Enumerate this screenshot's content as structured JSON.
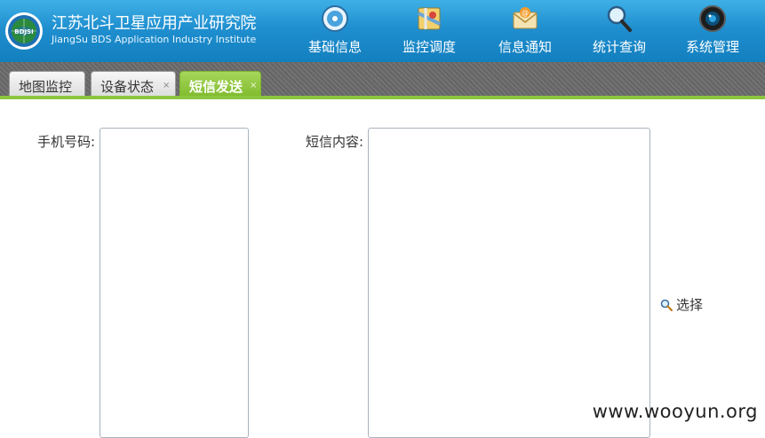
{
  "brand": {
    "name_cn": "江苏北斗卫星应用产业研究院",
    "name_en": "JiangSu BDS Application Industry Institute",
    "logo_text": "BDJSI"
  },
  "nav": [
    {
      "label": "基础信息",
      "icon": "info-disc-icon"
    },
    {
      "label": "监控调度",
      "icon": "map-monitor-icon"
    },
    {
      "label": "信息通知",
      "icon": "mail-envelope-icon"
    },
    {
      "label": "统计查询",
      "icon": "magnifier-icon"
    },
    {
      "label": "系统管理",
      "icon": "camera-lens-icon"
    }
  ],
  "tabs": [
    {
      "label": "地图监控",
      "closable": false,
      "active": false
    },
    {
      "label": "设备状态",
      "closable": true,
      "active": false
    },
    {
      "label": "短信发送",
      "closable": true,
      "active": true
    }
  ],
  "tab_close_glyph": "×",
  "form": {
    "phone_label": "手机号码:",
    "phone_value": "",
    "content_label": "短信内容:",
    "content_value": "",
    "select_label": "选择"
  },
  "watermark": "www.wooyun.org",
  "colors": {
    "header_blue": "#1f8fcf",
    "active_tab_green": "#8cc63f",
    "tabbar_gray": "#6a6a6a"
  }
}
